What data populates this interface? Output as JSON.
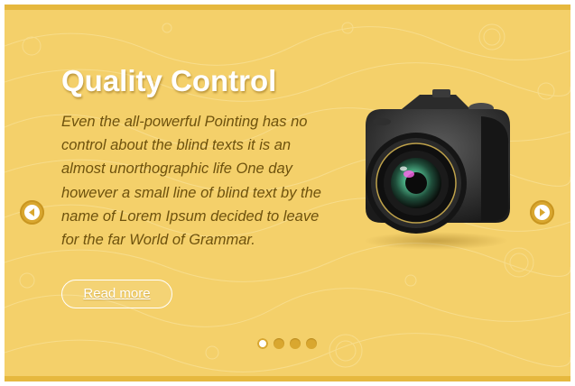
{
  "slide": {
    "title": "Quality Control",
    "body": "Even the all-powerful Pointing has no control about the blind texts it is an almost unorthographic life One day however a small line of blind text by the name of Lorem Ipsum decided to leave for the far World of Grammar.",
    "read_more_label": "Read more",
    "image_icon": "camera-icon"
  },
  "navigation": {
    "prev_icon": "arrow-left-icon",
    "next_icon": "arrow-right-icon",
    "dots": [
      {
        "active": true
      },
      {
        "active": false
      },
      {
        "active": false
      },
      {
        "active": false
      }
    ]
  },
  "colors": {
    "background": "#f4d06a",
    "border": "#e6b83e",
    "accent": "#d9a72f",
    "body_text": "#6e520d",
    "title_text": "#ffffff"
  }
}
